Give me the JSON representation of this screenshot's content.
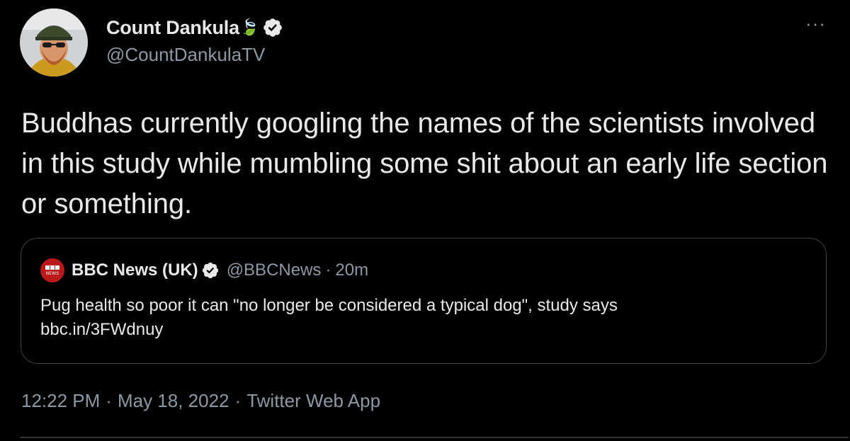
{
  "author": {
    "display_name": "Count Dankula",
    "name_emoji": "🍃",
    "handle": "@CountDankulaTV",
    "verified_icon": "verified-badge-icon"
  },
  "more_label": "···",
  "tweet_text": "Buddhas currently googling the names of the scientists involved in this study while mumbling some shit about an early life section or something.",
  "quote": {
    "logo_label": "NEWS",
    "display_name": "BBC News (UK)",
    "handle": "@BBCNews",
    "separator": "·",
    "time": "20m",
    "text_line1": "Pug health so poor it can \"no longer be considered a typical dog\", study says",
    "text_line2": "bbc.in/3FWdnuy"
  },
  "meta": {
    "time": "12:22 PM",
    "separator": "·",
    "date": "May 18, 2022",
    "source": "Twitter Web App"
  },
  "colors": {
    "background": "#000000",
    "text_primary": "#e7e9ea",
    "text_secondary": "#8b98a5",
    "border": "#3e4144",
    "bbc_red": "#bb1919"
  }
}
